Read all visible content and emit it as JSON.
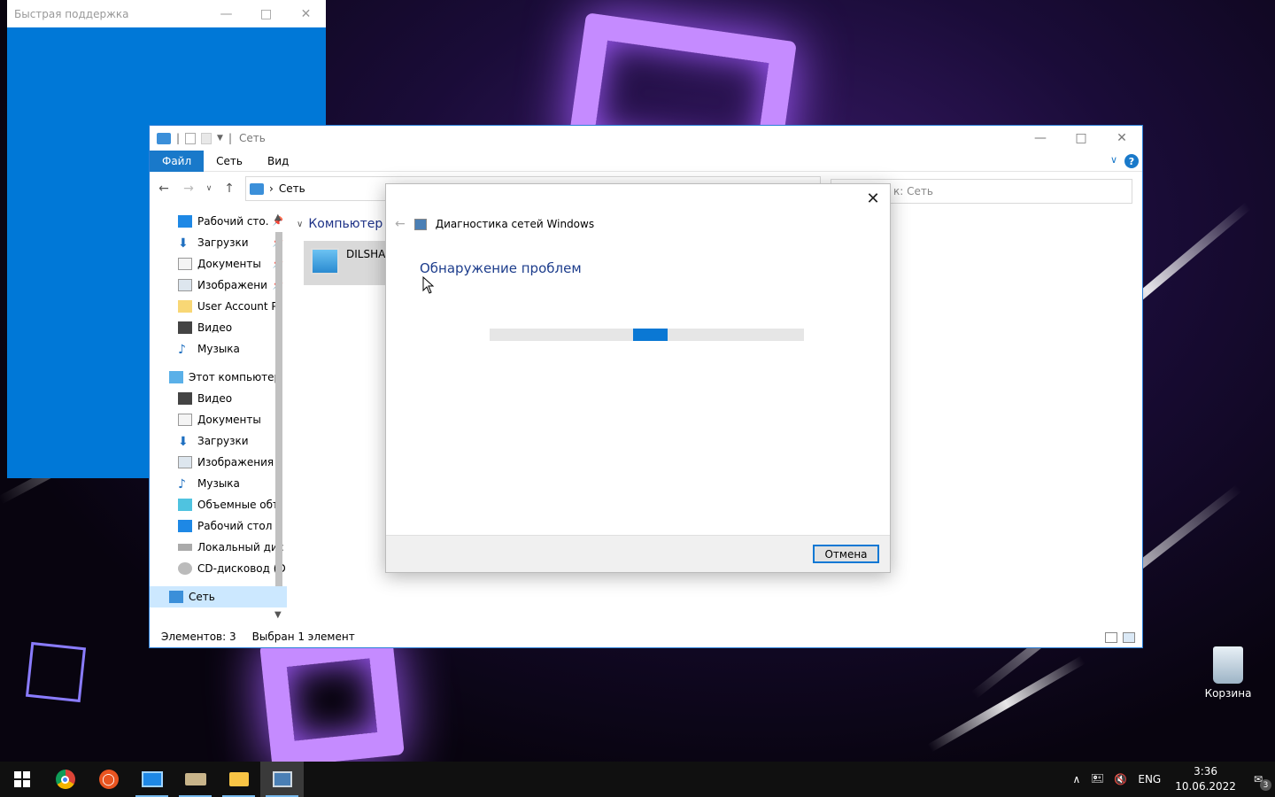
{
  "quick_assist": {
    "title": "Быстрая поддержка"
  },
  "explorer": {
    "title": "Сеть",
    "ribbon": {
      "file_tab": "Файл",
      "network_tab": "Сеть",
      "view_tab": "Вид",
      "help": "?"
    },
    "address": {
      "location": "Сеть"
    },
    "search": {
      "placeholder": "к: Сеть"
    },
    "sidebar": {
      "quick_access": [
        {
          "label": "Рабочий сто.",
          "icon": "desktop-icon",
          "pinned": true
        },
        {
          "label": "Загрузки",
          "icon": "download-icon",
          "pinned": true
        },
        {
          "label": "Документы",
          "icon": "documents-icon",
          "pinned": true
        },
        {
          "label": "Изображени",
          "icon": "pictures-icon",
          "pinned": true
        },
        {
          "label": "User Account Pi",
          "icon": "folder-icon",
          "pinned": false
        },
        {
          "label": "Видео",
          "icon": "video-icon",
          "pinned": false
        },
        {
          "label": "Музыка",
          "icon": "music-icon",
          "pinned": false
        }
      ],
      "this_pc": "Этот компьютер",
      "this_pc_items": [
        {
          "label": "Видео",
          "icon": "video-icon"
        },
        {
          "label": "Документы",
          "icon": "documents-icon"
        },
        {
          "label": "Загрузки",
          "icon": "download-icon"
        },
        {
          "label": "Изображения",
          "icon": "pictures-icon"
        },
        {
          "label": "Музыка",
          "icon": "music-icon"
        },
        {
          "label": "Объемные объ",
          "icon": "3d-objects-icon"
        },
        {
          "label": "Рабочий стол",
          "icon": "desktop-icon"
        },
        {
          "label": "Локальный дис",
          "icon": "drive-icon"
        },
        {
          "label": "CD-дисковод (D",
          "icon": "cd-drive-icon"
        }
      ],
      "network": "Сеть"
    },
    "content": {
      "group_header": "Компьютер",
      "computer_name": "DILSHA"
    },
    "status": {
      "count": "Элементов: 3",
      "selected": "Выбран 1 элемент"
    }
  },
  "dialog": {
    "title": "Диагностика сетей Windows",
    "heading": "Обнаружение проблем",
    "cancel_label": "Отмена",
    "progress": "indeterminate"
  },
  "desktop": {
    "recycle_bin_label": "Корзина"
  },
  "taskbar": {
    "apps": [
      "windows-start-icon",
      "chrome-icon",
      "ubuntu-icon",
      "remote-desktop-icon",
      "scanner-icon",
      "file-explorer-icon",
      "network-diagnostics-icon"
    ],
    "language": "ENG",
    "time": "3:36",
    "date": "10.06.2022",
    "notifications_count": "3"
  },
  "colors": {
    "accent": "#0078d7",
    "link_heading": "#1d3d8c",
    "progress": "#0a78d4"
  }
}
